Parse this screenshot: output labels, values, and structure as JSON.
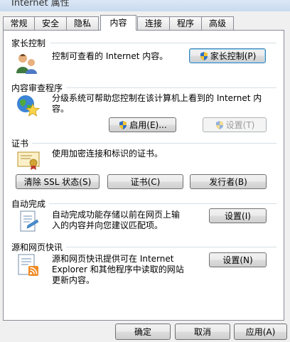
{
  "window": {
    "title": "Internet 属性"
  },
  "tabs": [
    {
      "label": "常规"
    },
    {
      "label": "安全"
    },
    {
      "label": "隐私"
    },
    {
      "label": "内容"
    },
    {
      "label": "连接"
    },
    {
      "label": "程序"
    },
    {
      "label": "高级"
    }
  ],
  "active_tab": "内容",
  "parental": {
    "title": "家长控制",
    "desc": "控制可查看的 Internet 内容。",
    "button": "家长控制(P)"
  },
  "advisor": {
    "title": "内容审查程序",
    "desc_line1": "分级系统可帮助您控制在该计算机上看到的 Internet 内",
    "desc_line2": "容。",
    "enable_button": "启用(E)...",
    "settings_button": "设置(T)"
  },
  "certificates": {
    "title": "证书",
    "desc": "使用加密连接和标识的证书。",
    "clear_ssl_button": "清除 SSL 状态(S)",
    "certificates_button": "证书(C)",
    "publishers_button": "发行者(B)"
  },
  "autocomplete": {
    "title": "自动完成",
    "desc_line1": "自动完成功能存储以前在网页上输",
    "desc_line2": "入的内容并向您建议匹配项。",
    "settings_button": "设置(I)"
  },
  "feeds": {
    "title": "源和网页快讯",
    "desc_line1": "源和网页快讯提供可在 Internet",
    "desc_line2": "Explorer 和其他程序中读取的网站",
    "desc_line3": "更新内容。",
    "settings_button": "设置(N)"
  },
  "footer": {
    "ok": "确定",
    "cancel": "取消",
    "apply": "应用(A)"
  },
  "colors": {
    "accent": "#3c7fb1",
    "panel_bg": "#ffffff",
    "window_bg": "#f0f0f0"
  }
}
